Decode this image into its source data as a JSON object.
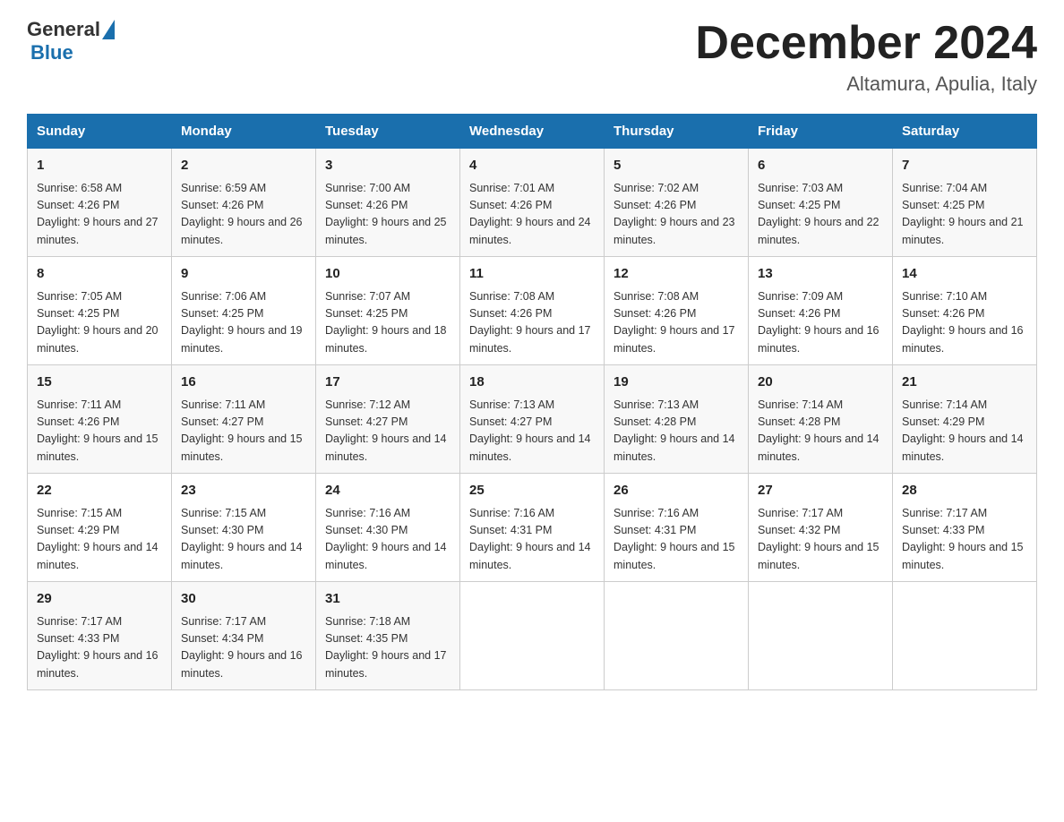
{
  "header": {
    "logo_general": "General",
    "logo_blue": "Blue",
    "title": "December 2024",
    "location": "Altamura, Apulia, Italy"
  },
  "days_of_week": [
    "Sunday",
    "Monday",
    "Tuesday",
    "Wednesday",
    "Thursday",
    "Friday",
    "Saturday"
  ],
  "weeks": [
    [
      {
        "day": "1",
        "sunrise": "6:58 AM",
        "sunset": "4:26 PM",
        "daylight": "9 hours and 27 minutes."
      },
      {
        "day": "2",
        "sunrise": "6:59 AM",
        "sunset": "4:26 PM",
        "daylight": "9 hours and 26 minutes."
      },
      {
        "day": "3",
        "sunrise": "7:00 AM",
        "sunset": "4:26 PM",
        "daylight": "9 hours and 25 minutes."
      },
      {
        "day": "4",
        "sunrise": "7:01 AM",
        "sunset": "4:26 PM",
        "daylight": "9 hours and 24 minutes."
      },
      {
        "day": "5",
        "sunrise": "7:02 AM",
        "sunset": "4:26 PM",
        "daylight": "9 hours and 23 minutes."
      },
      {
        "day": "6",
        "sunrise": "7:03 AM",
        "sunset": "4:25 PM",
        "daylight": "9 hours and 22 minutes."
      },
      {
        "day": "7",
        "sunrise": "7:04 AM",
        "sunset": "4:25 PM",
        "daylight": "9 hours and 21 minutes."
      }
    ],
    [
      {
        "day": "8",
        "sunrise": "7:05 AM",
        "sunset": "4:25 PM",
        "daylight": "9 hours and 20 minutes."
      },
      {
        "day": "9",
        "sunrise": "7:06 AM",
        "sunset": "4:25 PM",
        "daylight": "9 hours and 19 minutes."
      },
      {
        "day": "10",
        "sunrise": "7:07 AM",
        "sunset": "4:25 PM",
        "daylight": "9 hours and 18 minutes."
      },
      {
        "day": "11",
        "sunrise": "7:08 AM",
        "sunset": "4:26 PM",
        "daylight": "9 hours and 17 minutes."
      },
      {
        "day": "12",
        "sunrise": "7:08 AM",
        "sunset": "4:26 PM",
        "daylight": "9 hours and 17 minutes."
      },
      {
        "day": "13",
        "sunrise": "7:09 AM",
        "sunset": "4:26 PM",
        "daylight": "9 hours and 16 minutes."
      },
      {
        "day": "14",
        "sunrise": "7:10 AM",
        "sunset": "4:26 PM",
        "daylight": "9 hours and 16 minutes."
      }
    ],
    [
      {
        "day": "15",
        "sunrise": "7:11 AM",
        "sunset": "4:26 PM",
        "daylight": "9 hours and 15 minutes."
      },
      {
        "day": "16",
        "sunrise": "7:11 AM",
        "sunset": "4:27 PM",
        "daylight": "9 hours and 15 minutes."
      },
      {
        "day": "17",
        "sunrise": "7:12 AM",
        "sunset": "4:27 PM",
        "daylight": "9 hours and 14 minutes."
      },
      {
        "day": "18",
        "sunrise": "7:13 AM",
        "sunset": "4:27 PM",
        "daylight": "9 hours and 14 minutes."
      },
      {
        "day": "19",
        "sunrise": "7:13 AM",
        "sunset": "4:28 PM",
        "daylight": "9 hours and 14 minutes."
      },
      {
        "day": "20",
        "sunrise": "7:14 AM",
        "sunset": "4:28 PM",
        "daylight": "9 hours and 14 minutes."
      },
      {
        "day": "21",
        "sunrise": "7:14 AM",
        "sunset": "4:29 PM",
        "daylight": "9 hours and 14 minutes."
      }
    ],
    [
      {
        "day": "22",
        "sunrise": "7:15 AM",
        "sunset": "4:29 PM",
        "daylight": "9 hours and 14 minutes."
      },
      {
        "day": "23",
        "sunrise": "7:15 AM",
        "sunset": "4:30 PM",
        "daylight": "9 hours and 14 minutes."
      },
      {
        "day": "24",
        "sunrise": "7:16 AM",
        "sunset": "4:30 PM",
        "daylight": "9 hours and 14 minutes."
      },
      {
        "day": "25",
        "sunrise": "7:16 AM",
        "sunset": "4:31 PM",
        "daylight": "9 hours and 14 minutes."
      },
      {
        "day": "26",
        "sunrise": "7:16 AM",
        "sunset": "4:31 PM",
        "daylight": "9 hours and 15 minutes."
      },
      {
        "day": "27",
        "sunrise": "7:17 AM",
        "sunset": "4:32 PM",
        "daylight": "9 hours and 15 minutes."
      },
      {
        "day": "28",
        "sunrise": "7:17 AM",
        "sunset": "4:33 PM",
        "daylight": "9 hours and 15 minutes."
      }
    ],
    [
      {
        "day": "29",
        "sunrise": "7:17 AM",
        "sunset": "4:33 PM",
        "daylight": "9 hours and 16 minutes."
      },
      {
        "day": "30",
        "sunrise": "7:17 AM",
        "sunset": "4:34 PM",
        "daylight": "9 hours and 16 minutes."
      },
      {
        "day": "31",
        "sunrise": "7:18 AM",
        "sunset": "4:35 PM",
        "daylight": "9 hours and 17 minutes."
      },
      null,
      null,
      null,
      null
    ]
  ]
}
